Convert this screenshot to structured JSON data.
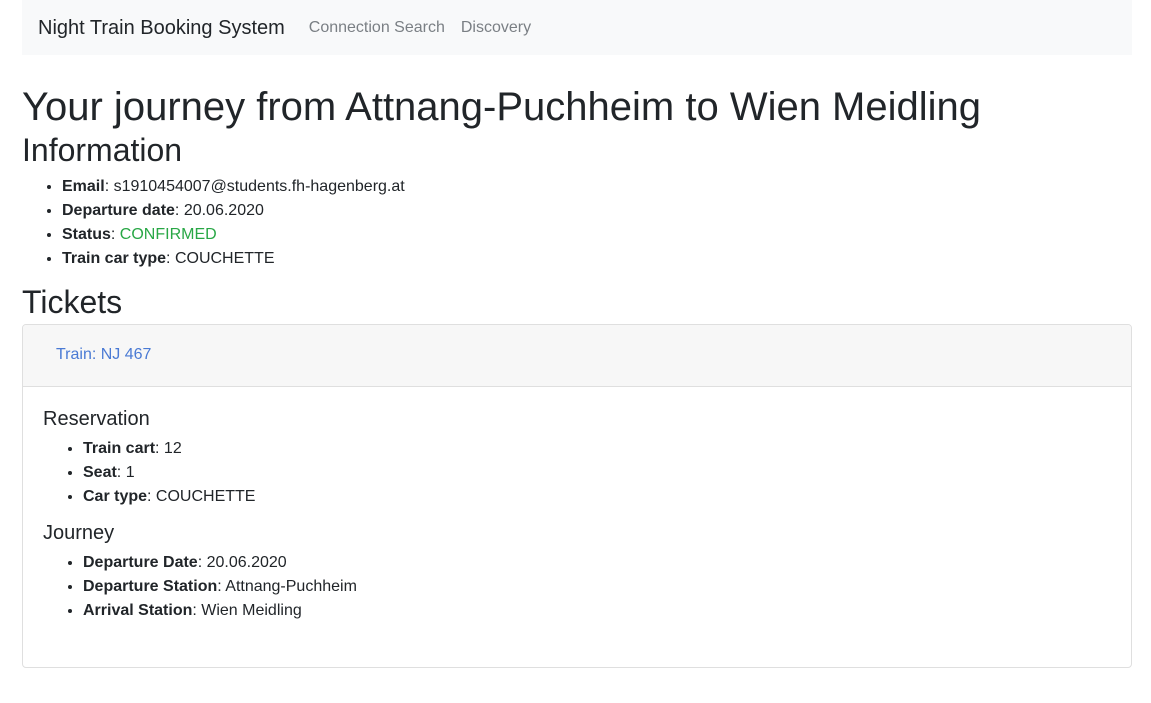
{
  "navbar": {
    "brand": "Night Train Booking System",
    "links": [
      "Connection Search",
      "Discovery"
    ]
  },
  "page": {
    "title": "Your journey from Attnang-Puchheim to Wien Meidling"
  },
  "information": {
    "heading": "Information",
    "items": [
      {
        "label": "Email",
        "value": "s1910454007@students.fh-hagenberg.at"
      },
      {
        "label": "Departure date",
        "value": "20.06.2020"
      },
      {
        "label": "Status",
        "value": "CONFIRMED"
      },
      {
        "label": "Train car type",
        "value": "COUCHETTE"
      }
    ]
  },
  "tickets": {
    "heading": "Tickets",
    "cards": [
      {
        "train_label": "Train: NJ 467",
        "reservation": {
          "heading": "Reservation",
          "items": [
            {
              "label": "Train cart",
              "value": "12"
            },
            {
              "label": "Seat",
              "value": "1"
            },
            {
              "label": "Car type",
              "value": "COUCHETTE"
            }
          ]
        },
        "journey": {
          "heading": "Journey",
          "items": [
            {
              "label": "Departure Date",
              "value": "20.06.2020"
            },
            {
              "label": "Departure Station",
              "value": "Attnang-Puchheim"
            },
            {
              "label": "Arrival Station",
              "value": "Wien Meidling"
            }
          ]
        }
      }
    ]
  },
  "colors": {
    "status_confirmed": "#28a745",
    "link": "#4a7ad4",
    "nav_background": "#f8f9fa"
  }
}
